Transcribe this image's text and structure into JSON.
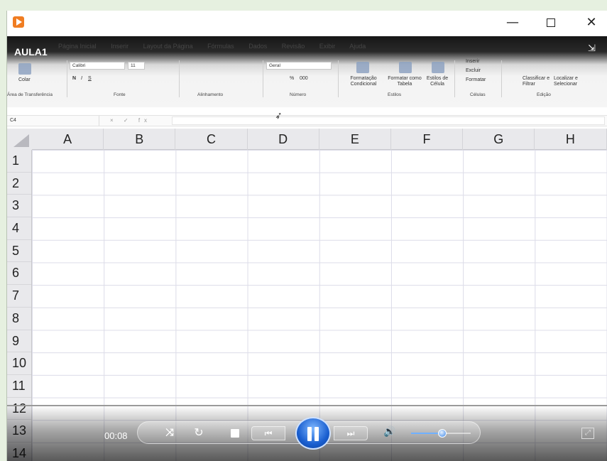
{
  "window": {
    "app_icon": "media-player-icon",
    "minimize_glyph": "—",
    "close_glyph": "✕"
  },
  "video": {
    "title": "AULA1",
    "fullscreen_glyph": "⇲"
  },
  "ribbon": {
    "tabs": [
      "Página Inicial",
      "Inserir",
      "Layout da Página",
      "Fórmulas",
      "Dados",
      "Revisão",
      "Exibir",
      "Ajuda"
    ],
    "clipboard": {
      "paste": "Colar",
      "group": "Área de Transferência"
    },
    "font": {
      "name": "Calibri",
      "size": "11",
      "bold": "N",
      "italic": "I",
      "underline": "S",
      "group": "Fonte"
    },
    "alignment": {
      "group": "Alinhamento"
    },
    "number": {
      "format": "Geral",
      "percent": "%",
      "thousands": "000",
      "group": "Número"
    },
    "styles": {
      "cond_format": "Formatação Condicional",
      "format_table": "Formatar como Tabela",
      "cell_styles": "Estilos de Célula",
      "group": "Estilos"
    },
    "cells": {
      "insert": "Inserir",
      "delete": "Excluir",
      "format": "Formatar",
      "group": "Células"
    },
    "editing": {
      "sort_filter": "Classificar e Filtrar",
      "find_select": "Localizar e Selecionar",
      "group": "Edição"
    }
  },
  "formula_bar": {
    "name_box": "C4",
    "fx_symbols": "× ✓ fx",
    "value": ""
  },
  "sheet": {
    "columns": [
      "A",
      "B",
      "C",
      "D",
      "E",
      "F",
      "G",
      "H"
    ],
    "rows": [
      "1",
      "2",
      "3",
      "4",
      "5",
      "6",
      "7",
      "8",
      "9",
      "10",
      "11",
      "12",
      "13",
      "14"
    ]
  },
  "player": {
    "time": "00:08",
    "shuffle_glyph": "⤨",
    "repeat_glyph": "↻",
    "prev_glyph": "⏮",
    "next_glyph": "⏭",
    "volume_glyph": "🔊",
    "volume_level": 0.52,
    "state": "playing",
    "colors": {
      "accent": "#1a5fd0"
    }
  }
}
